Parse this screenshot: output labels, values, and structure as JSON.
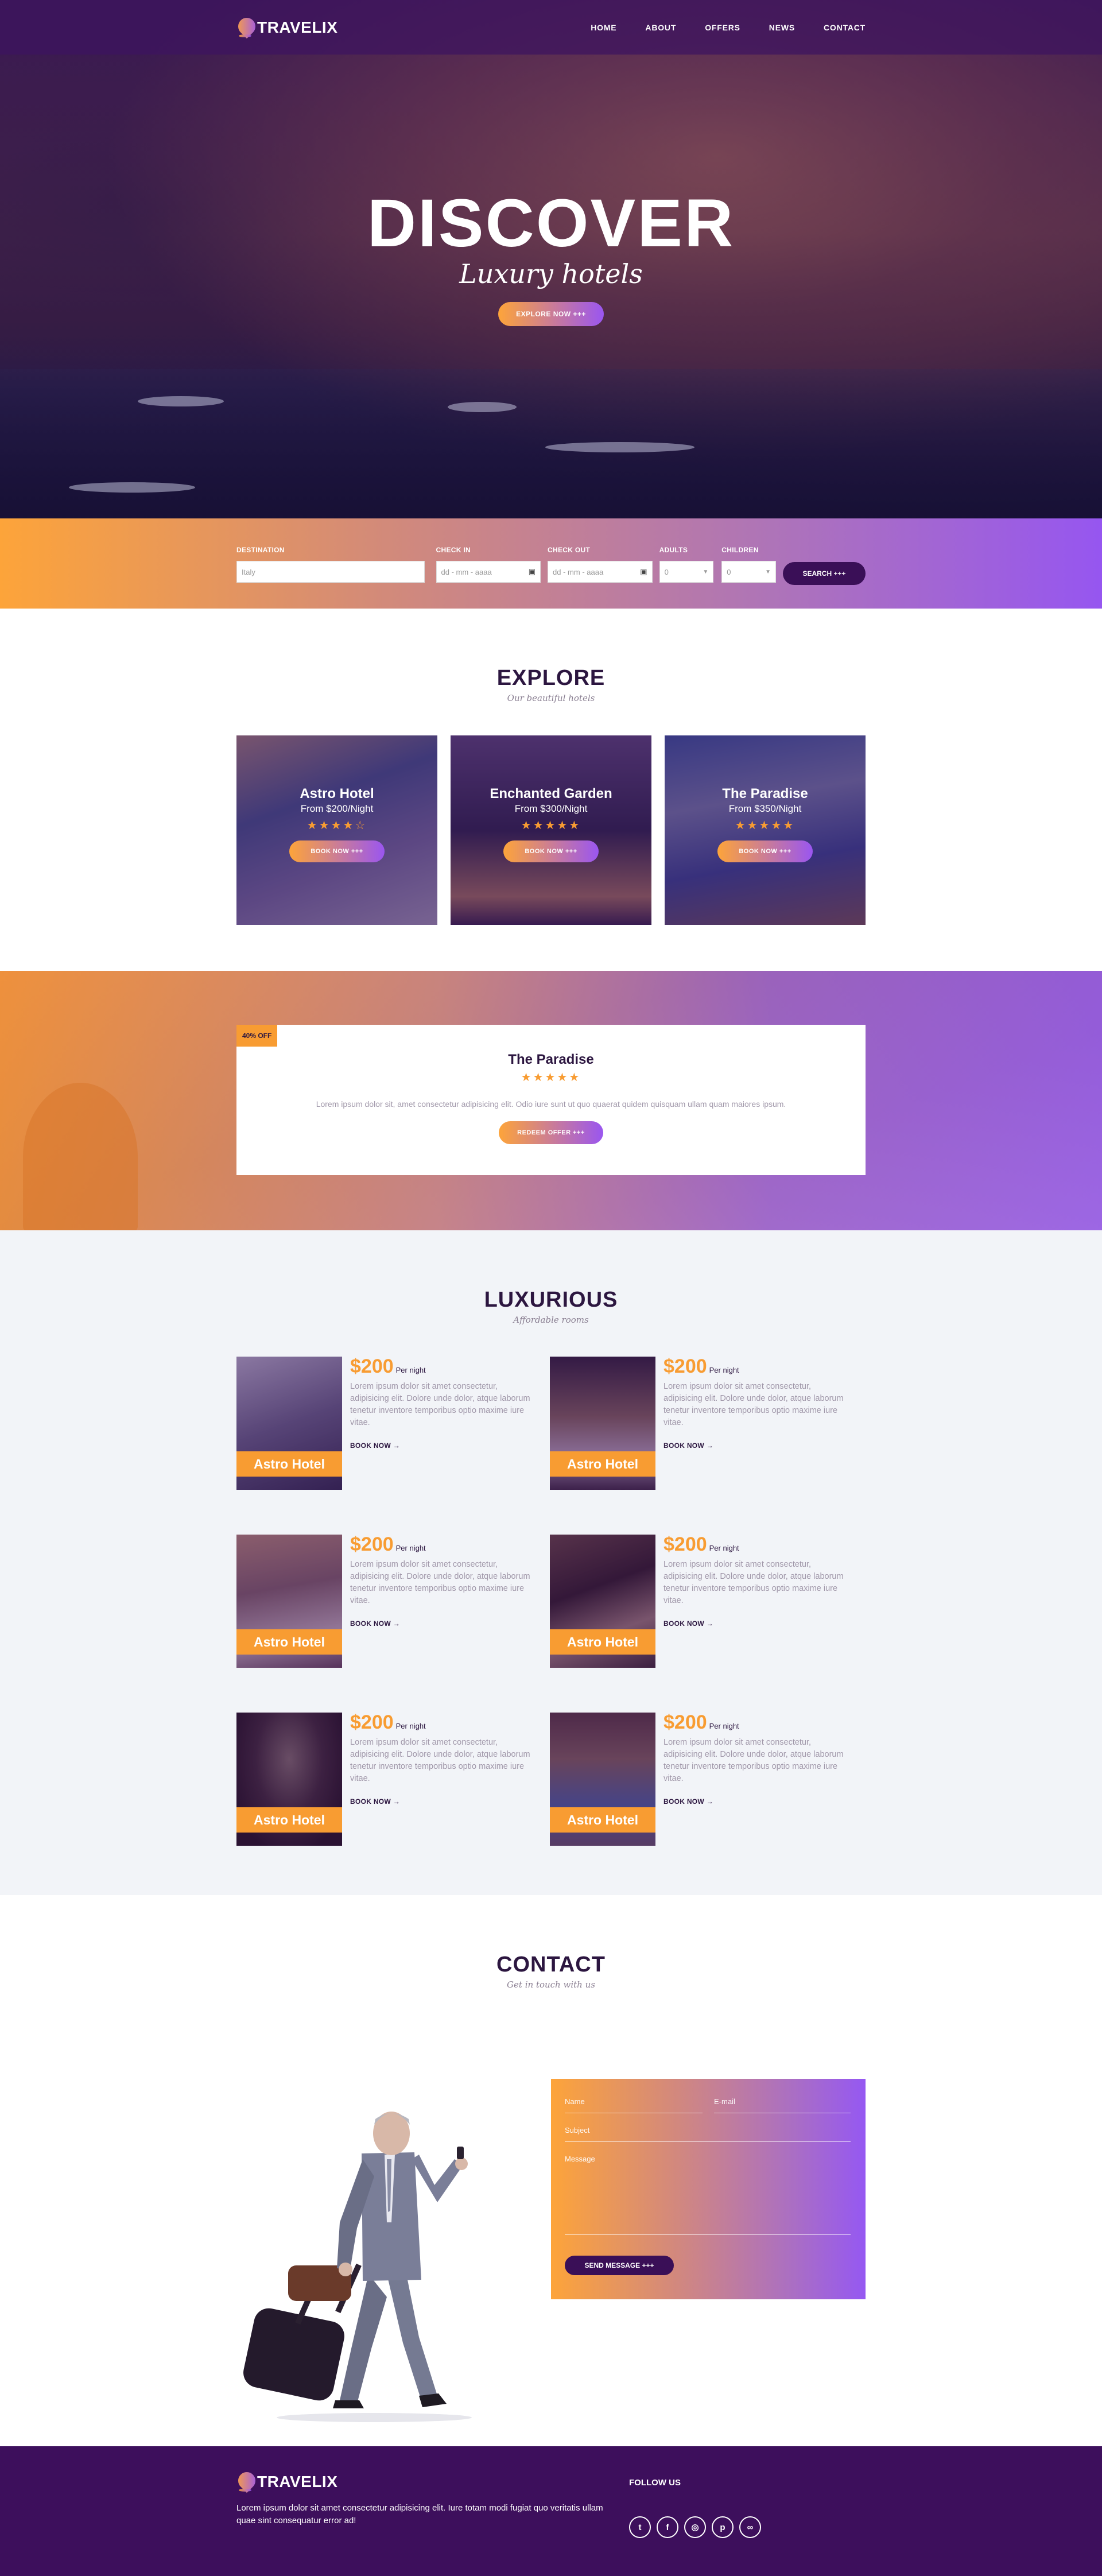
{
  "brand": {
    "name": "TRAVELIX"
  },
  "nav": {
    "items": [
      "HOME",
      "ABOUT",
      "OFFERS",
      "NEWS",
      "CONTACT"
    ]
  },
  "hero": {
    "title": "DISCOVER",
    "subtitle": "Luxury hotels",
    "button": "EXPLORE NOW +++"
  },
  "search": {
    "destination": {
      "label": "DESTINATION",
      "placeholder": "Italy"
    },
    "check_in": {
      "label": "CHECK IN",
      "placeholder": "dd - mm - aaaa"
    },
    "check_out": {
      "label": "CHECK OUT",
      "placeholder": "dd - mm - aaaa"
    },
    "adults": {
      "label": "ADULTS",
      "value": "0"
    },
    "children": {
      "label": "CHILDREN",
      "value": "0"
    },
    "button": "SEARCH +++"
  },
  "explore": {
    "title": "EXPLORE",
    "subtitle": "Our beautiful hotels",
    "hotels": [
      {
        "name": "Astro Hotel",
        "price": "From $200/Night",
        "stars": "★★★★☆",
        "button": "BOOK NOW +++"
      },
      {
        "name": "Enchanted Garden",
        "price": "From $300/Night",
        "stars": "★★★★★",
        "button": "BOOK NOW +++"
      },
      {
        "name": "The Paradise",
        "price": "From $350/Night",
        "stars": "★★★★★",
        "button": "BOOK NOW +++"
      }
    ]
  },
  "offer": {
    "badge": "40% OFF",
    "name": "The Paradise",
    "stars": "★★★★★",
    "text": "Lorem ipsum dolor sit, amet consectetur adipisicing elit. Odio iure sunt ut quo quaerat quidem quisquam ullam quam maiores ipsum.",
    "button": "REDEEM OFFER +++"
  },
  "luxurious": {
    "title": "LUXURIOUS",
    "subtitle": "Affordable rooms",
    "rooms": [
      {
        "label": "Astro Hotel",
        "price": "$200",
        "per": "Per night",
        "text": "Lorem ipsum dolor sit amet consectetur, adipisicing elit. Dolore unde dolor, atque laborum tenetur inventore temporibus optio maxime iure vitae.",
        "link": "BOOK NOW →"
      },
      {
        "label": "Astro Hotel",
        "price": "$200",
        "per": "Per night",
        "text": "Lorem ipsum dolor sit amet consectetur, adipisicing elit. Dolore unde dolor, atque laborum tenetur inventore temporibus optio maxime iure vitae.",
        "link": "BOOK NOW →"
      },
      {
        "label": "Astro Hotel",
        "price": "$200",
        "per": "Per night",
        "text": "Lorem ipsum dolor sit amet consectetur, adipisicing elit. Dolore unde dolor, atque laborum tenetur inventore temporibus optio maxime iure vitae.",
        "link": "BOOK NOW →"
      },
      {
        "label": "Astro Hotel",
        "price": "$200",
        "per": "Per night",
        "text": "Lorem ipsum dolor sit amet consectetur, adipisicing elit. Dolore unde dolor, atque laborum tenetur inventore temporibus optio maxime iure vitae.",
        "link": "BOOK NOW →"
      },
      {
        "label": "Astro Hotel",
        "price": "$200",
        "per": "Per night",
        "text": "Lorem ipsum dolor sit amet consectetur, adipisicing elit. Dolore unde dolor, atque laborum tenetur inventore temporibus optio maxime iure vitae.",
        "link": "BOOK NOW →"
      },
      {
        "label": "Astro Hotel",
        "price": "$200",
        "per": "Per night",
        "text": "Lorem ipsum dolor sit amet consectetur, adipisicing elit. Dolore unde dolor, atque laborum tenetur inventore temporibus optio maxime iure vitae.",
        "link": "BOOK NOW →"
      }
    ]
  },
  "contact": {
    "title": "CONTACT",
    "subtitle": "Get in touch with us",
    "name_placeholder": "Name",
    "email_placeholder": "E-mail",
    "subject_placeholder": "Subject",
    "message_placeholder": "Message",
    "button": "SEND MESSAGE +++"
  },
  "footer": {
    "brand": "TRAVELIX",
    "text": "Lorem ipsum dolor sit amet consectetur adipisicing elit. Iure totam modi fugiat quo veritatis ullam quae sint consequatur error ad!",
    "follow": "FOLLOW US",
    "socials": [
      {
        "icon": "twitter-icon",
        "glyph": "t"
      },
      {
        "icon": "facebook-icon",
        "glyph": "f"
      },
      {
        "icon": "instagram-icon",
        "glyph": "◎"
      },
      {
        "icon": "pinterest-icon",
        "glyph": "p"
      },
      {
        "icon": "tripadvisor-icon",
        "glyph": "∞"
      }
    ]
  },
  "colors": {
    "orange": "#fda43a",
    "purple": "#9656f0",
    "dark": "#3d0f5c",
    "star": "#f89c32"
  }
}
